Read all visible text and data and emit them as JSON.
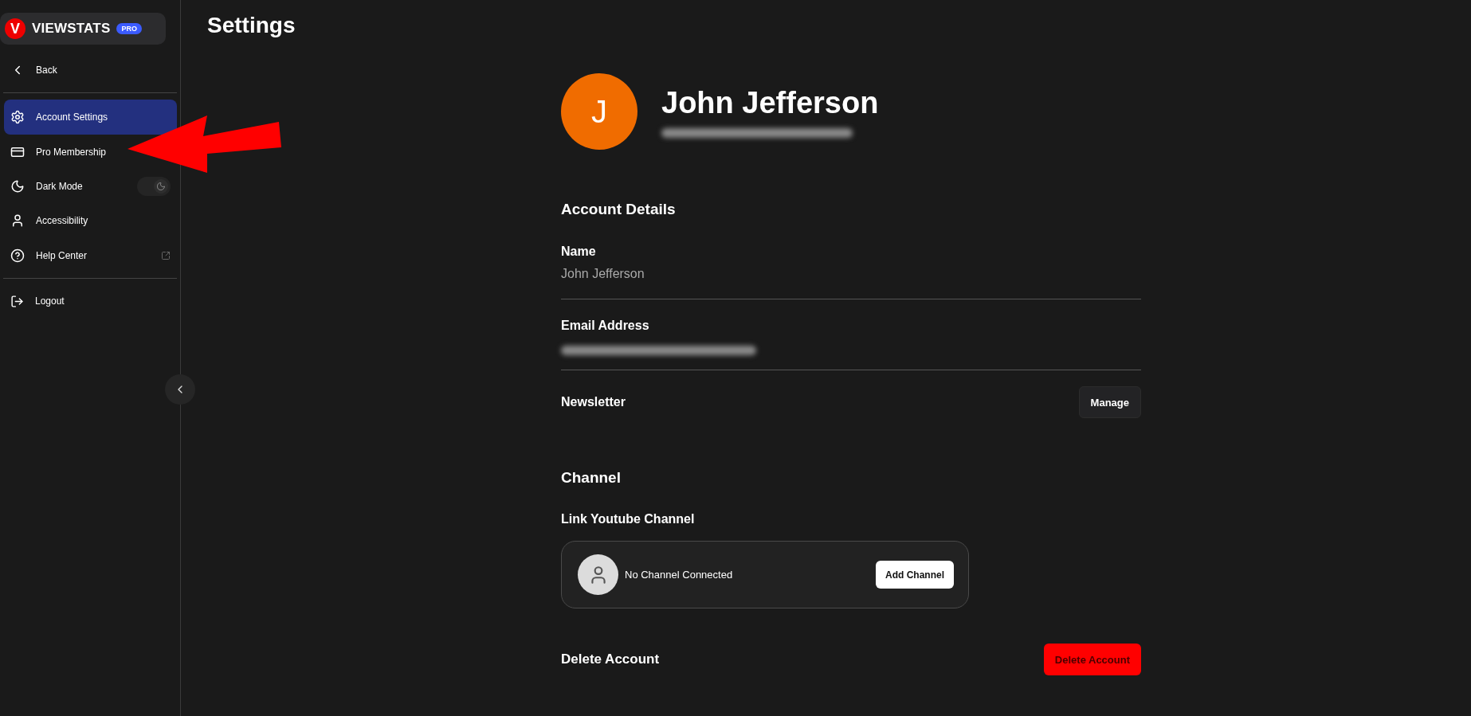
{
  "sidebar": {
    "logo": {
      "letter": "V",
      "name": "VIEWSTATS",
      "badge": "PRO"
    },
    "back": {
      "label": "Back"
    },
    "items": [
      {
        "label": "Account Settings",
        "kind": "settings",
        "selected": true
      },
      {
        "label": "Pro Membership",
        "kind": "card",
        "selected": false
      },
      {
        "label": "Dark Mode",
        "kind": "toggle",
        "on": true,
        "selected": false
      },
      {
        "label": "Accessibility",
        "kind": "person",
        "selected": false
      },
      {
        "label": "Help Center",
        "kind": "external",
        "selected": false
      }
    ],
    "logout": {
      "label": "Logout"
    }
  },
  "page": {
    "title": "Settings"
  },
  "profile": {
    "initial": "J",
    "name": "John Jefferson",
    "email_redacted": true
  },
  "account_details": {
    "title": "Account Details",
    "fields": [
      {
        "label": "Name",
        "value": "John Jefferson",
        "redacted": false
      },
      {
        "label": "Email Address",
        "redacted": true
      }
    ],
    "newsletter": {
      "label": "Newsletter",
      "button": "Manage"
    }
  },
  "channel": {
    "title": "Channel",
    "subtitle": "Link Youtube Channel",
    "status": "No Channel Connected",
    "button": "Add Channel"
  },
  "delete": {
    "label": "Delete Account",
    "button": "Delete Account"
  },
  "annotation": {
    "kind": "arrow"
  }
}
